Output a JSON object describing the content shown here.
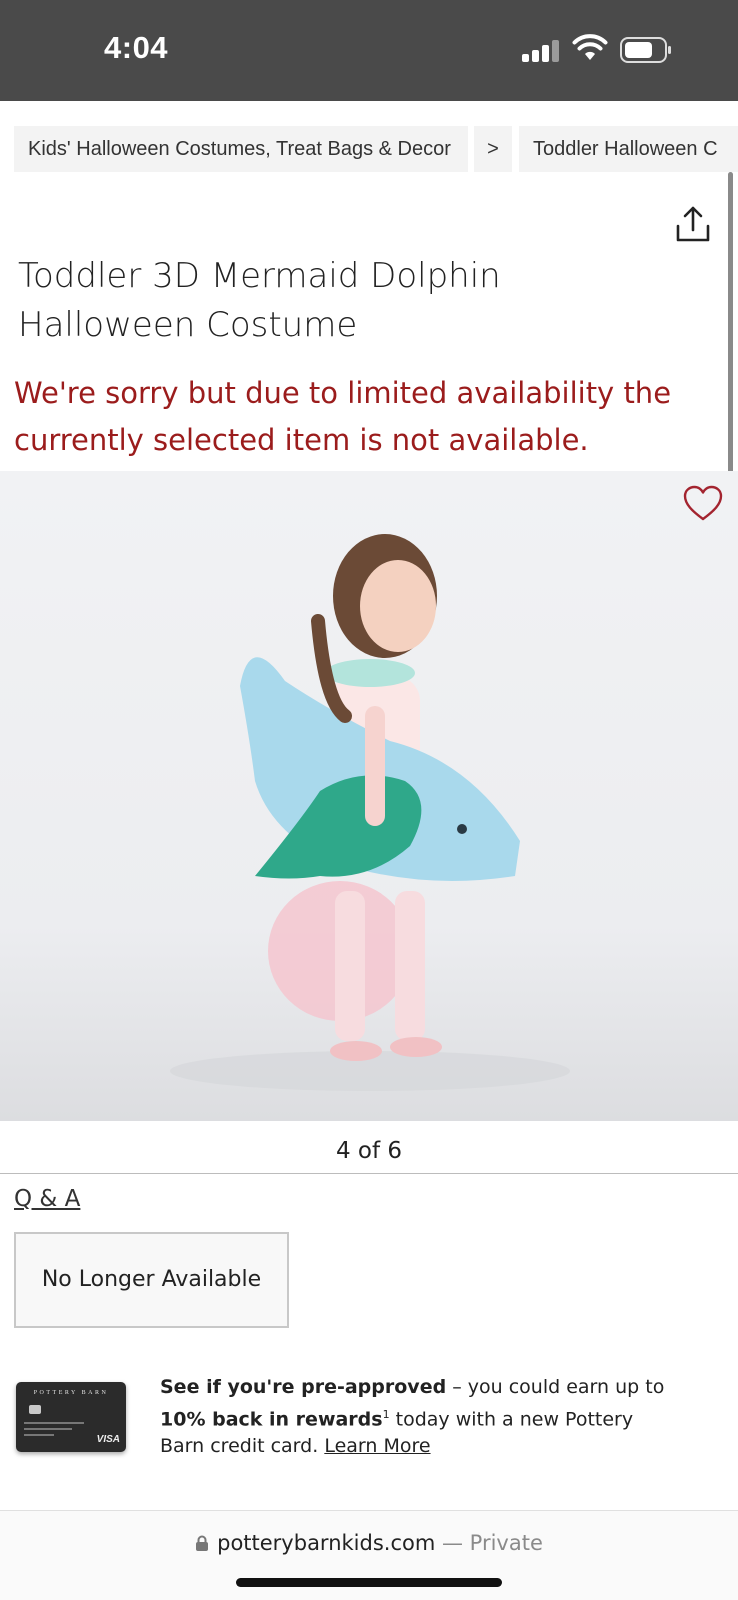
{
  "status": {
    "time": "4:04"
  },
  "breadcrumb": {
    "items": [
      "Kids' Halloween Costumes, Treat Bags & Decor",
      "Toddler Halloween C"
    ],
    "separator": ">"
  },
  "product": {
    "title": "Toddler 3D Mermaid Dolphin Halloween Costume",
    "availability_message": "We're sorry but due to limited availability the currently selected item is not available.",
    "image_counter": "4 of 6",
    "qa_link": "Q & A",
    "status_box": "No Longer Available"
  },
  "promo": {
    "strong_1": "See if you're pre-approved",
    "text_1": " – you could earn up to ",
    "strong_2": "10% back in rewards",
    "sup": "1",
    "text_2": " today with a new Pottery Barn credit card. ",
    "link": "Learn More",
    "card_brand": "POTTERY BARN",
    "card_network": "VISA"
  },
  "browser": {
    "domain": "potterybarnkids.com",
    "mode": " — Private"
  },
  "colors": {
    "status_bar": "#4a4a4a",
    "alert_text": "#9b1c1c",
    "favorite_heart": "#a3242f"
  },
  "icons": [
    "signal-icon",
    "wifi-icon",
    "battery-icon",
    "share-icon",
    "heart-icon",
    "lock-icon"
  ]
}
